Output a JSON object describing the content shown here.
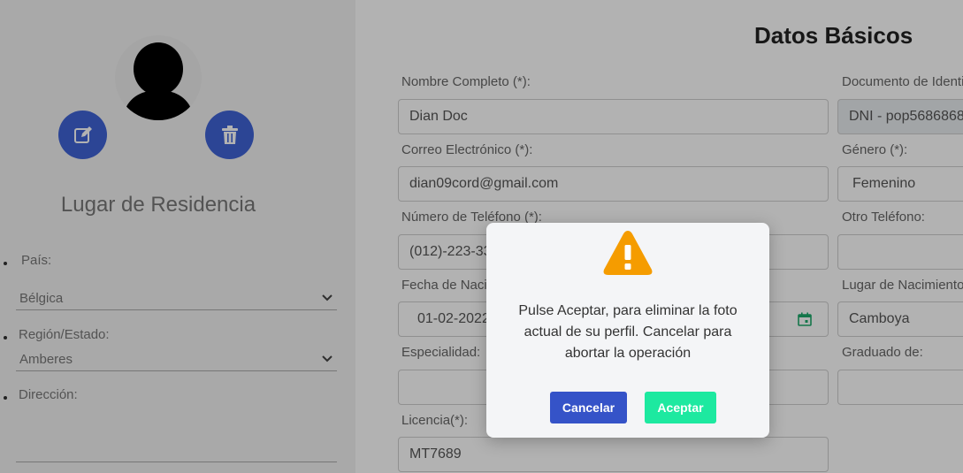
{
  "left_panel": {
    "residence_title": "Lugar de Residencia",
    "country_label": "País:",
    "country_value": "Bélgica",
    "region_label": "Región/Estado:",
    "region_value": "Amberes",
    "address_label": "Dirección:"
  },
  "form": {
    "title": "Datos Básicos",
    "full_name_label": "Nombre Completo (*):",
    "full_name_value": "Dian Doc",
    "document_label": "Documento de Identi",
    "document_value": "DNI - pop5686868",
    "email_label": "Correo Electrónico (*):",
    "email_value": "dian09cord@gmail.com",
    "gender_label": "Género (*):",
    "gender_value": "Femenino",
    "phone_label": "Número de Teléfono (*):",
    "phone_value": "(012)-223-33",
    "other_phone_label": "Otro Teléfono:",
    "birth_date_label": "Fecha de Naci",
    "birth_date_value": "01-02-2022",
    "birth_place_label": "Lugar de Nacimiento",
    "birth_place_value": "Camboya",
    "specialty_label": "Especialidad:",
    "graduated_label": "Graduado de:",
    "license_label": "Licencia(*):",
    "license_value": "MT7689"
  },
  "modal": {
    "message": "Pulse Aceptar, para eliminar la foto actual de su perfil. Cancelar para abortar la operación",
    "cancel_label": "Cancelar",
    "accept_label": "Aceptar"
  },
  "colors": {
    "primary_blue": "#3f63d6",
    "cancel_blue": "#3553c8",
    "accept_green": "#1de9a0",
    "warning_orange": "#f59c00"
  },
  "icons": [
    "edit-icon",
    "trash-icon",
    "chevron-down-icon",
    "calendar-icon",
    "warning-icon"
  ]
}
